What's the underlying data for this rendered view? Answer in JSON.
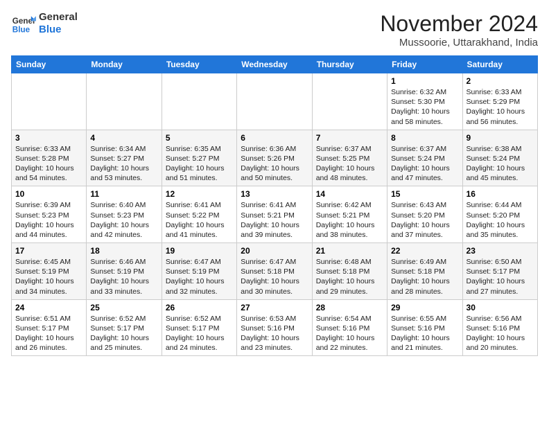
{
  "header": {
    "logo_general": "General",
    "logo_blue": "Blue",
    "month": "November 2024",
    "location": "Mussoorie, Uttarakhand, India"
  },
  "days_of_week": [
    "Sunday",
    "Monday",
    "Tuesday",
    "Wednesday",
    "Thursday",
    "Friday",
    "Saturday"
  ],
  "weeks": [
    [
      {
        "day": "",
        "info": ""
      },
      {
        "day": "",
        "info": ""
      },
      {
        "day": "",
        "info": ""
      },
      {
        "day": "",
        "info": ""
      },
      {
        "day": "",
        "info": ""
      },
      {
        "day": "1",
        "info": "Sunrise: 6:32 AM\nSunset: 5:30 PM\nDaylight: 10 hours and 58 minutes."
      },
      {
        "day": "2",
        "info": "Sunrise: 6:33 AM\nSunset: 5:29 PM\nDaylight: 10 hours and 56 minutes."
      }
    ],
    [
      {
        "day": "3",
        "info": "Sunrise: 6:33 AM\nSunset: 5:28 PM\nDaylight: 10 hours and 54 minutes."
      },
      {
        "day": "4",
        "info": "Sunrise: 6:34 AM\nSunset: 5:27 PM\nDaylight: 10 hours and 53 minutes."
      },
      {
        "day": "5",
        "info": "Sunrise: 6:35 AM\nSunset: 5:27 PM\nDaylight: 10 hours and 51 minutes."
      },
      {
        "day": "6",
        "info": "Sunrise: 6:36 AM\nSunset: 5:26 PM\nDaylight: 10 hours and 50 minutes."
      },
      {
        "day": "7",
        "info": "Sunrise: 6:37 AM\nSunset: 5:25 PM\nDaylight: 10 hours and 48 minutes."
      },
      {
        "day": "8",
        "info": "Sunrise: 6:37 AM\nSunset: 5:24 PM\nDaylight: 10 hours and 47 minutes."
      },
      {
        "day": "9",
        "info": "Sunrise: 6:38 AM\nSunset: 5:24 PM\nDaylight: 10 hours and 45 minutes."
      }
    ],
    [
      {
        "day": "10",
        "info": "Sunrise: 6:39 AM\nSunset: 5:23 PM\nDaylight: 10 hours and 44 minutes."
      },
      {
        "day": "11",
        "info": "Sunrise: 6:40 AM\nSunset: 5:23 PM\nDaylight: 10 hours and 42 minutes."
      },
      {
        "day": "12",
        "info": "Sunrise: 6:41 AM\nSunset: 5:22 PM\nDaylight: 10 hours and 41 minutes."
      },
      {
        "day": "13",
        "info": "Sunrise: 6:41 AM\nSunset: 5:21 PM\nDaylight: 10 hours and 39 minutes."
      },
      {
        "day": "14",
        "info": "Sunrise: 6:42 AM\nSunset: 5:21 PM\nDaylight: 10 hours and 38 minutes."
      },
      {
        "day": "15",
        "info": "Sunrise: 6:43 AM\nSunset: 5:20 PM\nDaylight: 10 hours and 37 minutes."
      },
      {
        "day": "16",
        "info": "Sunrise: 6:44 AM\nSunset: 5:20 PM\nDaylight: 10 hours and 35 minutes."
      }
    ],
    [
      {
        "day": "17",
        "info": "Sunrise: 6:45 AM\nSunset: 5:19 PM\nDaylight: 10 hours and 34 minutes."
      },
      {
        "day": "18",
        "info": "Sunrise: 6:46 AM\nSunset: 5:19 PM\nDaylight: 10 hours and 33 minutes."
      },
      {
        "day": "19",
        "info": "Sunrise: 6:47 AM\nSunset: 5:19 PM\nDaylight: 10 hours and 32 minutes."
      },
      {
        "day": "20",
        "info": "Sunrise: 6:47 AM\nSunset: 5:18 PM\nDaylight: 10 hours and 30 minutes."
      },
      {
        "day": "21",
        "info": "Sunrise: 6:48 AM\nSunset: 5:18 PM\nDaylight: 10 hours and 29 minutes."
      },
      {
        "day": "22",
        "info": "Sunrise: 6:49 AM\nSunset: 5:18 PM\nDaylight: 10 hours and 28 minutes."
      },
      {
        "day": "23",
        "info": "Sunrise: 6:50 AM\nSunset: 5:17 PM\nDaylight: 10 hours and 27 minutes."
      }
    ],
    [
      {
        "day": "24",
        "info": "Sunrise: 6:51 AM\nSunset: 5:17 PM\nDaylight: 10 hours and 26 minutes."
      },
      {
        "day": "25",
        "info": "Sunrise: 6:52 AM\nSunset: 5:17 PM\nDaylight: 10 hours and 25 minutes."
      },
      {
        "day": "26",
        "info": "Sunrise: 6:52 AM\nSunset: 5:17 PM\nDaylight: 10 hours and 24 minutes."
      },
      {
        "day": "27",
        "info": "Sunrise: 6:53 AM\nSunset: 5:16 PM\nDaylight: 10 hours and 23 minutes."
      },
      {
        "day": "28",
        "info": "Sunrise: 6:54 AM\nSunset: 5:16 PM\nDaylight: 10 hours and 22 minutes."
      },
      {
        "day": "29",
        "info": "Sunrise: 6:55 AM\nSunset: 5:16 PM\nDaylight: 10 hours and 21 minutes."
      },
      {
        "day": "30",
        "info": "Sunrise: 6:56 AM\nSunset: 5:16 PM\nDaylight: 10 hours and 20 minutes."
      }
    ]
  ]
}
